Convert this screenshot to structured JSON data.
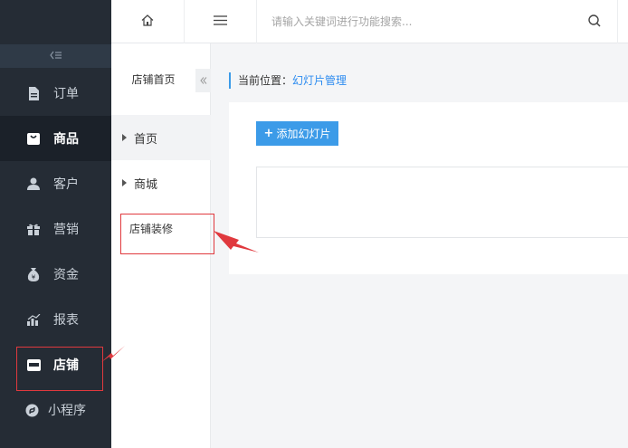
{
  "sidebar": {
    "items": [
      {
        "label": "订单",
        "icon": "document-icon"
      },
      {
        "label": "商品",
        "icon": "bag-icon"
      },
      {
        "label": "客户",
        "icon": "user-icon"
      },
      {
        "label": "营销",
        "icon": "gift-icon"
      },
      {
        "label": "资金",
        "icon": "money-bag-icon"
      },
      {
        "label": "报表",
        "icon": "bar-chart-icon"
      },
      {
        "label": "店铺",
        "icon": "store-icon"
      },
      {
        "label": "小程序",
        "icon": "mini-program-icon"
      }
    ],
    "collapse_icon": "collapse-icon"
  },
  "header": {
    "search_placeholder": "请输入关键词进行功能搜索..."
  },
  "subnav": {
    "title": "店铺首页",
    "items": [
      {
        "label": "首页"
      },
      {
        "label": "商城"
      }
    ],
    "plain_item": "店铺装修"
  },
  "breadcrumb": {
    "prefix": "当前位置：",
    "current": "幻灯片管理"
  },
  "content": {
    "add_button_label": "添加幻灯片"
  },
  "colors": {
    "sidebar_bg": "#252c35",
    "accent": "#3c9be8",
    "annotation": "#e0393e"
  }
}
